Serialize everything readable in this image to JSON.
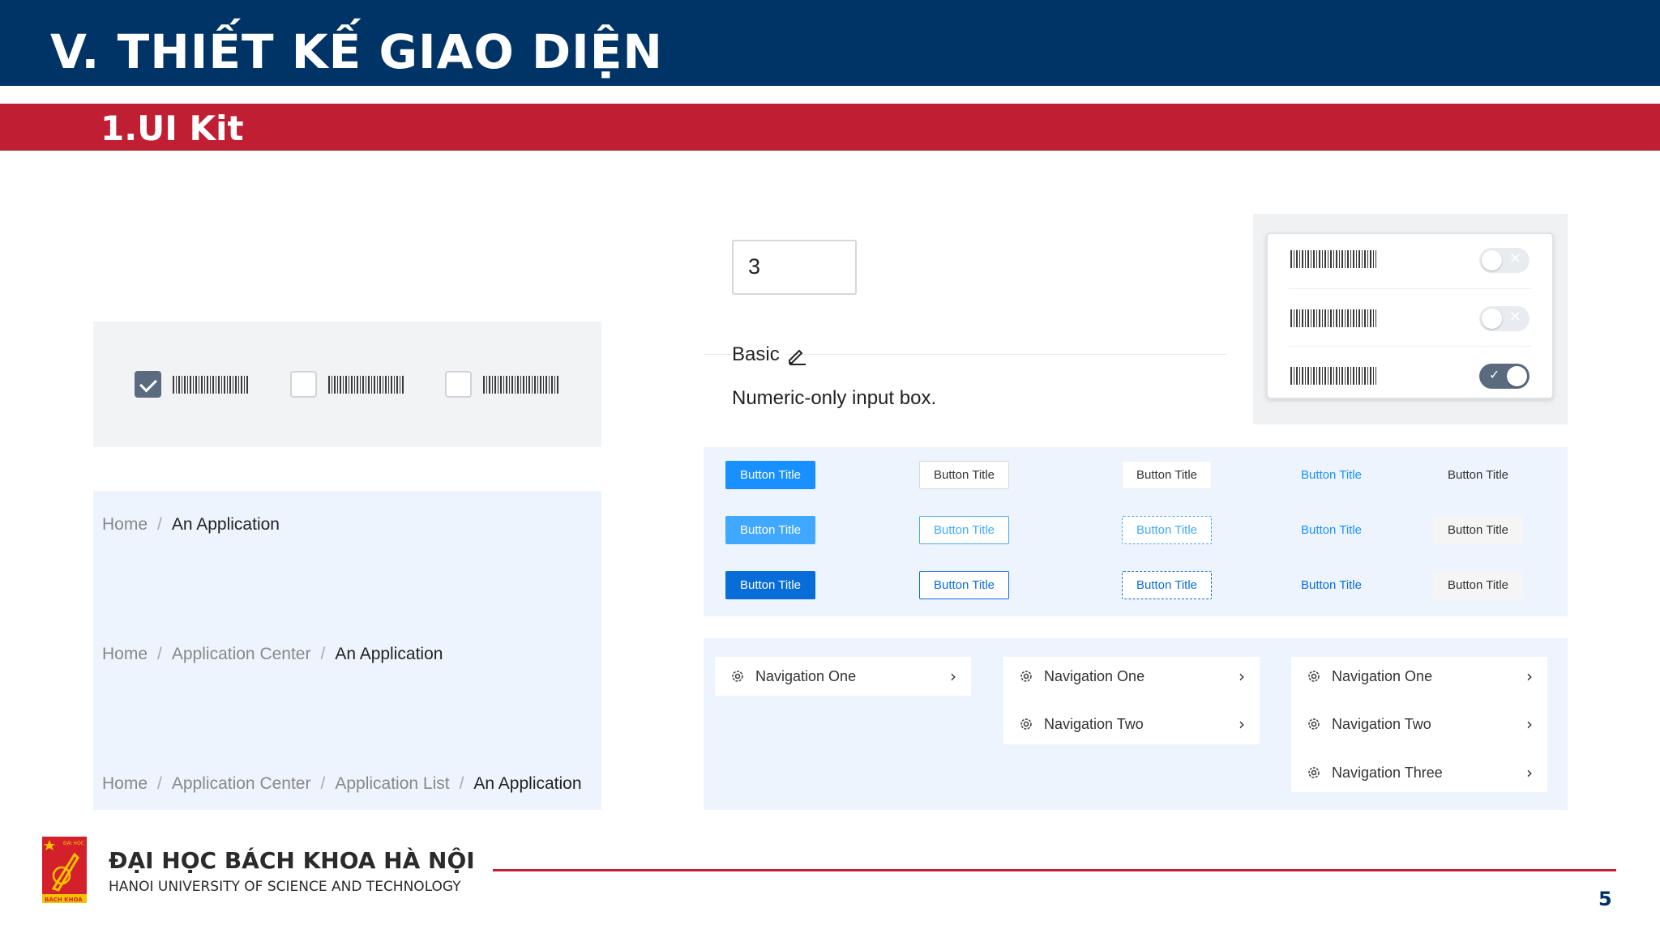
{
  "header": {
    "title": "V. THIẾT KẾ GIAO DIỆN",
    "subtitle": "1.UI Kit"
  },
  "number_input": {
    "value": "3",
    "label": "Basic",
    "description": "Numeric-only input box."
  },
  "switches": [
    {
      "on": false
    },
    {
      "on": false
    },
    {
      "on": true
    }
  ],
  "checkboxes": [
    {
      "checked": true
    },
    {
      "checked": false
    },
    {
      "checked": false
    }
  ],
  "breadcrumbs": [
    {
      "items": [
        "Home",
        "An Application"
      ]
    },
    {
      "items": [
        "Home",
        "Application Center",
        "An Application"
      ]
    },
    {
      "items": [
        "Home",
        "Application Center",
        "Application List",
        "An Application"
      ]
    }
  ],
  "breadcrumb_separator": "/",
  "buttons": {
    "label": "Button Title",
    "rows": [
      [
        "Button Title",
        "Button Title",
        "Button Title",
        "Button Title",
        "Button Title"
      ],
      [
        "Button Title",
        "Button Title",
        "Button Title",
        "Button Title",
        "Button Title"
      ],
      [
        "Button Title",
        "Button Title",
        "Button Title",
        "Button Title",
        "Button Title"
      ]
    ]
  },
  "navigation": {
    "menus": [
      [
        "Navigation One"
      ],
      [
        "Navigation One",
        "Navigation Two"
      ],
      [
        "Navigation One",
        "Navigation Two",
        "Navigation Three"
      ]
    ]
  },
  "footer": {
    "university_vn": "ĐẠI HỌC BÁCH KHOA HÀ NỘI",
    "university_en": "HANOI UNIVERSITY OF SCIENCE AND TECHNOLOGY",
    "page_number": "5",
    "logo_text_top": "ĐẠI HỌC",
    "logo_text_bottom": "BÁCH KHOA"
  },
  "colors": {
    "header_blue": "#003366",
    "accent_red": "#c01f33",
    "primary": "#1890ff"
  },
  "icons": {
    "nav_item": "gear-icon",
    "nav_arrow": "chevron-right-icon",
    "edit": "pencil-icon",
    "check": "check-icon"
  }
}
